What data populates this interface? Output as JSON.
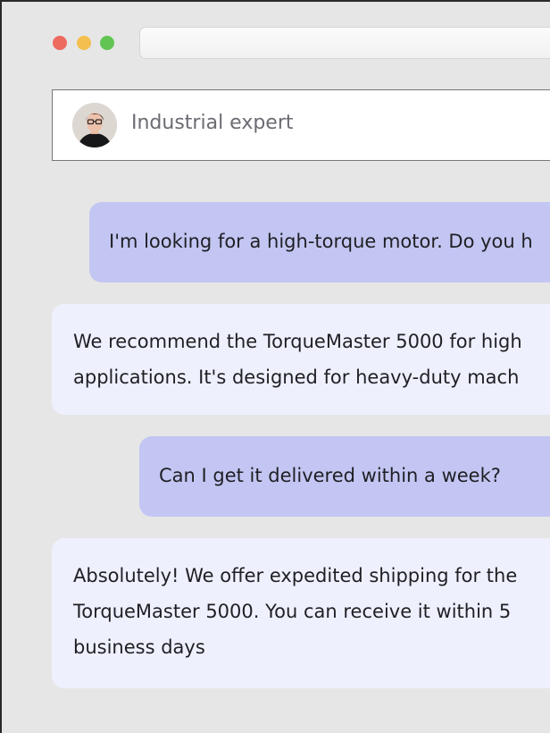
{
  "window": {
    "controls": [
      "close",
      "minimize",
      "zoom"
    ]
  },
  "header": {
    "title": "Industrial expert",
    "avatar_icon": "person-avatar-icon"
  },
  "messages": [
    {
      "role": "user",
      "lines": [
        "I'm looking for a high-torque motor. Do you h"
      ]
    },
    {
      "role": "assistant",
      "lines": [
        "We recommend the TorqueMaster 5000 for high",
        "applications. It's designed for heavy-duty mach"
      ]
    },
    {
      "role": "user",
      "lines": [
        "Can I get it delivered within a week?"
      ]
    },
    {
      "role": "assistant",
      "lines": [
        "Absolutely! We offer expedited shipping for the",
        "TorqueMaster 5000. You can receive it within 5",
        "business days"
      ]
    }
  ],
  "colors": {
    "background": "#e6e6e7",
    "user_bubble": "#c3c6f2",
    "assistant_bubble": "#eef0fd",
    "close": "#ec6a5e",
    "minimize": "#f4bf4f",
    "zoom": "#61c554"
  }
}
